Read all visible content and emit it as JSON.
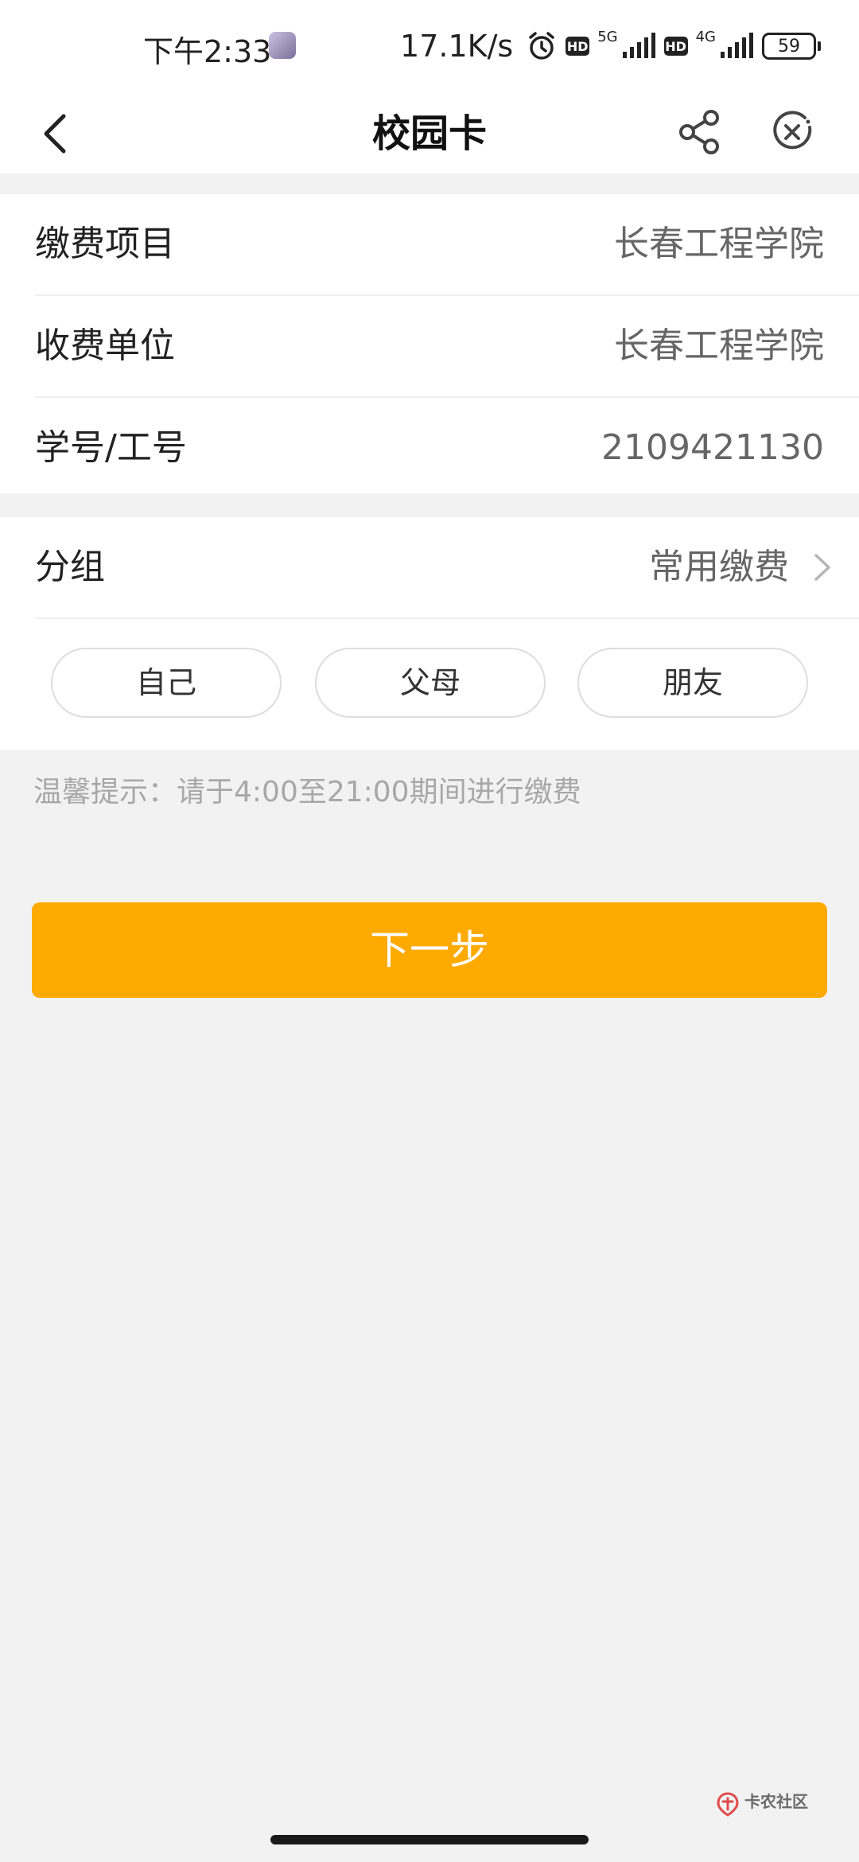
{
  "status_bar": {
    "time": "下午2:33",
    "net_speed": "17.1K/s",
    "hd_label": "HD",
    "network_1": "5G",
    "network_2": "4G",
    "battery": "59"
  },
  "nav": {
    "title": "校园卡"
  },
  "payment_info": {
    "rows": [
      {
        "label": "缴费项目",
        "value": "长春工程学院"
      },
      {
        "label": "收费单位",
        "value": "长春工程学院"
      },
      {
        "label": "学号/工号",
        "value": "2109421130"
      }
    ]
  },
  "group": {
    "label": "分组",
    "value": "常用缴费",
    "chips": [
      "自己",
      "父母",
      "朋友"
    ]
  },
  "tip": "温馨提示：请于4:00至21:00期间进行缴费",
  "next_button": "下一步",
  "watermark": {
    "text": "卡农社区"
  },
  "colors": {
    "accent": "#ffaa00",
    "background": "#f2f2f2"
  }
}
